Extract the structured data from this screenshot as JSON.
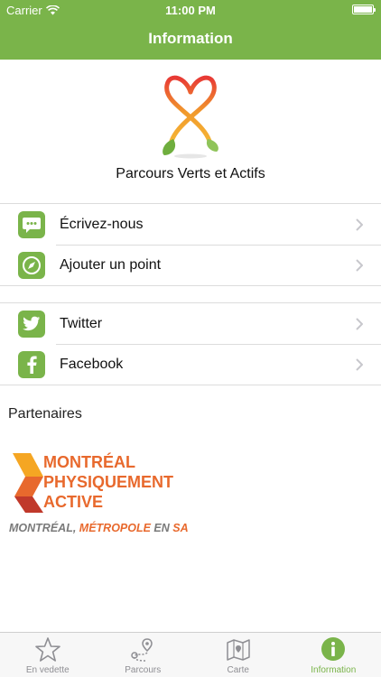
{
  "status_bar": {
    "carrier": "Carrier",
    "time": "11:00 PM",
    "battery_level": 1.0
  },
  "nav": {
    "title": "Information"
  },
  "app": {
    "name": "Parcours Verts et Actifs"
  },
  "contact_group": [
    {
      "label": "Écrivez-nous",
      "icon": "chat-icon"
    },
    {
      "label": "Ajouter un point",
      "icon": "compass-icon"
    }
  ],
  "social_group": [
    {
      "label": "Twitter",
      "icon": "twitter-icon"
    },
    {
      "label": "Facebook",
      "icon": "facebook-icon"
    }
  ],
  "partners": {
    "title": "Partenaires",
    "logo": {
      "line1": "MONTRÉAL",
      "line2": "PHYSIQUEMENT",
      "line3": "ACTIVE",
      "tagline_part1": "MONTRÉAL, ",
      "tagline_part2": "MÉTROPOLE",
      "tagline_part3": " EN ",
      "tagline_part4": "SANTÉ"
    }
  },
  "tabbar": [
    {
      "label": "En vedette",
      "icon": "star-icon",
      "active": false
    },
    {
      "label": "Parcours",
      "icon": "route-icon",
      "active": false
    },
    {
      "label": "Carte",
      "icon": "map-icon",
      "active": false
    },
    {
      "label": "Information",
      "icon": "info-icon",
      "active": true
    }
  ],
  "colors": {
    "accent": "#7ab44a",
    "partner_orange": "#e8692d",
    "partner_gray": "#7a7a7a",
    "tab_inactive": "#8e8e93"
  }
}
